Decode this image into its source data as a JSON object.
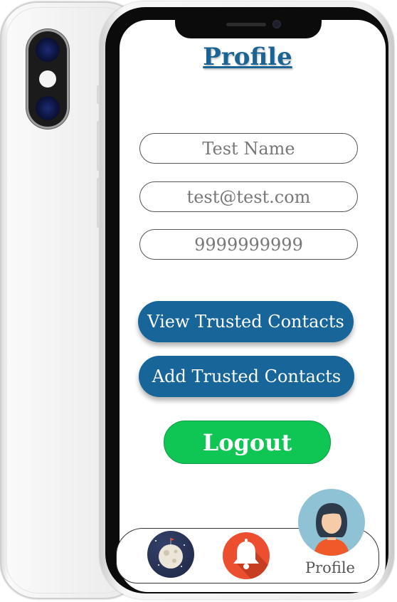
{
  "screen": {
    "title": "Profile"
  },
  "form": {
    "name_value": "Test Name",
    "email_value": "test@test.com",
    "phone_value": "9999999999"
  },
  "actions": {
    "view_trusted_label": "View Trusted Contacts",
    "add_trusted_label": "Add Trusted Contacts",
    "logout_label": "Logout"
  },
  "bottom_nav": {
    "items": [
      {
        "icon": "moon-icon"
      },
      {
        "icon": "bell-icon"
      },
      {
        "icon": "profile-avatar-icon",
        "label": "Profile"
      }
    ]
  },
  "colors": {
    "title": "#1a6395",
    "primary_button": "#176599",
    "logout_button": "#0fc654",
    "bell_background": "#eb4f2f",
    "profile_background": "#8ec2d4"
  }
}
